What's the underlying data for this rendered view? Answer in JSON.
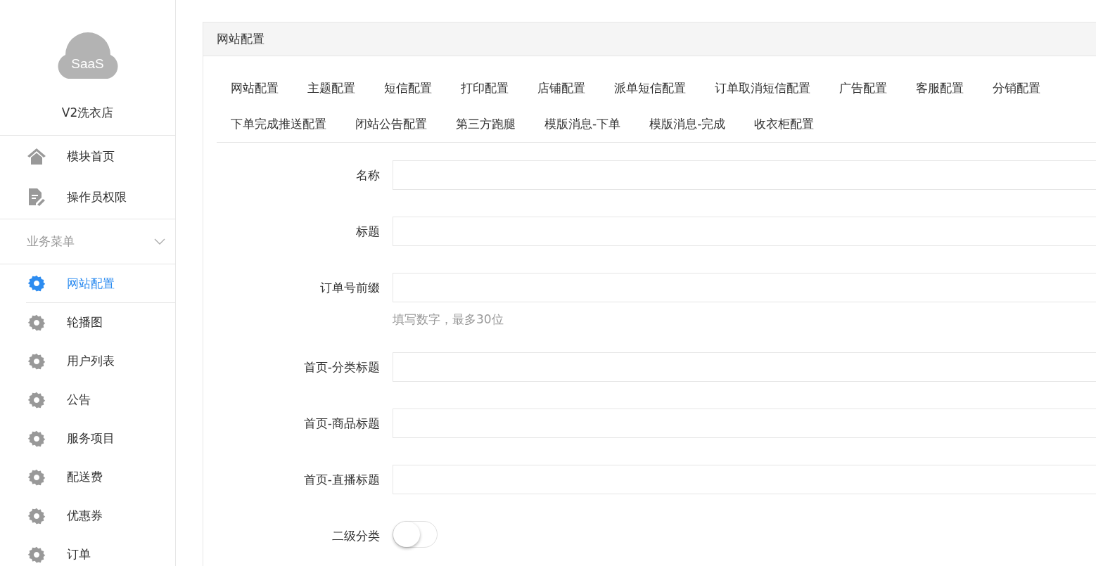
{
  "sidebar": {
    "logo_text": "SaaS",
    "shop_name": "V2洗衣店",
    "top_items": [
      {
        "label": "模块首页",
        "kind": "home"
      },
      {
        "label": "操作员权限",
        "kind": "document"
      }
    ],
    "section": {
      "label": "业务菜单",
      "expanded": true
    },
    "items": [
      {
        "label": "网站配置",
        "selected": true
      },
      {
        "label": "轮播图",
        "selected": false
      },
      {
        "label": "用户列表",
        "selected": false
      },
      {
        "label": "公告",
        "selected": false
      },
      {
        "label": "服务项目",
        "selected": false
      },
      {
        "label": "配送费",
        "selected": false
      },
      {
        "label": "优惠券",
        "selected": false
      },
      {
        "label": "订单",
        "selected": false
      }
    ]
  },
  "panel": {
    "title": "网站配置",
    "tabs": [
      {
        "label": "网站配置",
        "selected": false
      },
      {
        "label": "主题配置",
        "selected": false
      },
      {
        "label": "短信配置",
        "selected": false
      },
      {
        "label": "打印配置",
        "selected": false
      },
      {
        "label": "店铺配置",
        "selected": false
      },
      {
        "label": "派单短信配置",
        "selected": false
      },
      {
        "label": "订单取消短信配置",
        "selected": false
      },
      {
        "label": "广告配置",
        "selected": false
      },
      {
        "label": "客服配置",
        "selected": false
      },
      {
        "label": "分销配置",
        "selected": false
      },
      {
        "label": "下单完成推送配置",
        "selected": false
      },
      {
        "label": "闭站公告配置",
        "selected": false
      },
      {
        "label": "第三方跑腿",
        "selected": false
      },
      {
        "label": "模版消息-下单",
        "selected": false
      },
      {
        "label": "模版消息-完成",
        "selected": false
      },
      {
        "label": "收衣柜配置",
        "selected": false
      }
    ],
    "fields": [
      {
        "label": "名称",
        "kind": "text"
      },
      {
        "label": "标题",
        "kind": "text"
      },
      {
        "label": "订单号前缀",
        "kind": "text",
        "hint": "填写数字，最多30位"
      },
      {
        "label": "首页-分类标题",
        "kind": "text"
      },
      {
        "label": "首页-商品标题",
        "kind": "text"
      },
      {
        "label": "首页-直播标题",
        "kind": "text"
      },
      {
        "label": "二级分类",
        "kind": "switch",
        "on": false
      }
    ]
  }
}
